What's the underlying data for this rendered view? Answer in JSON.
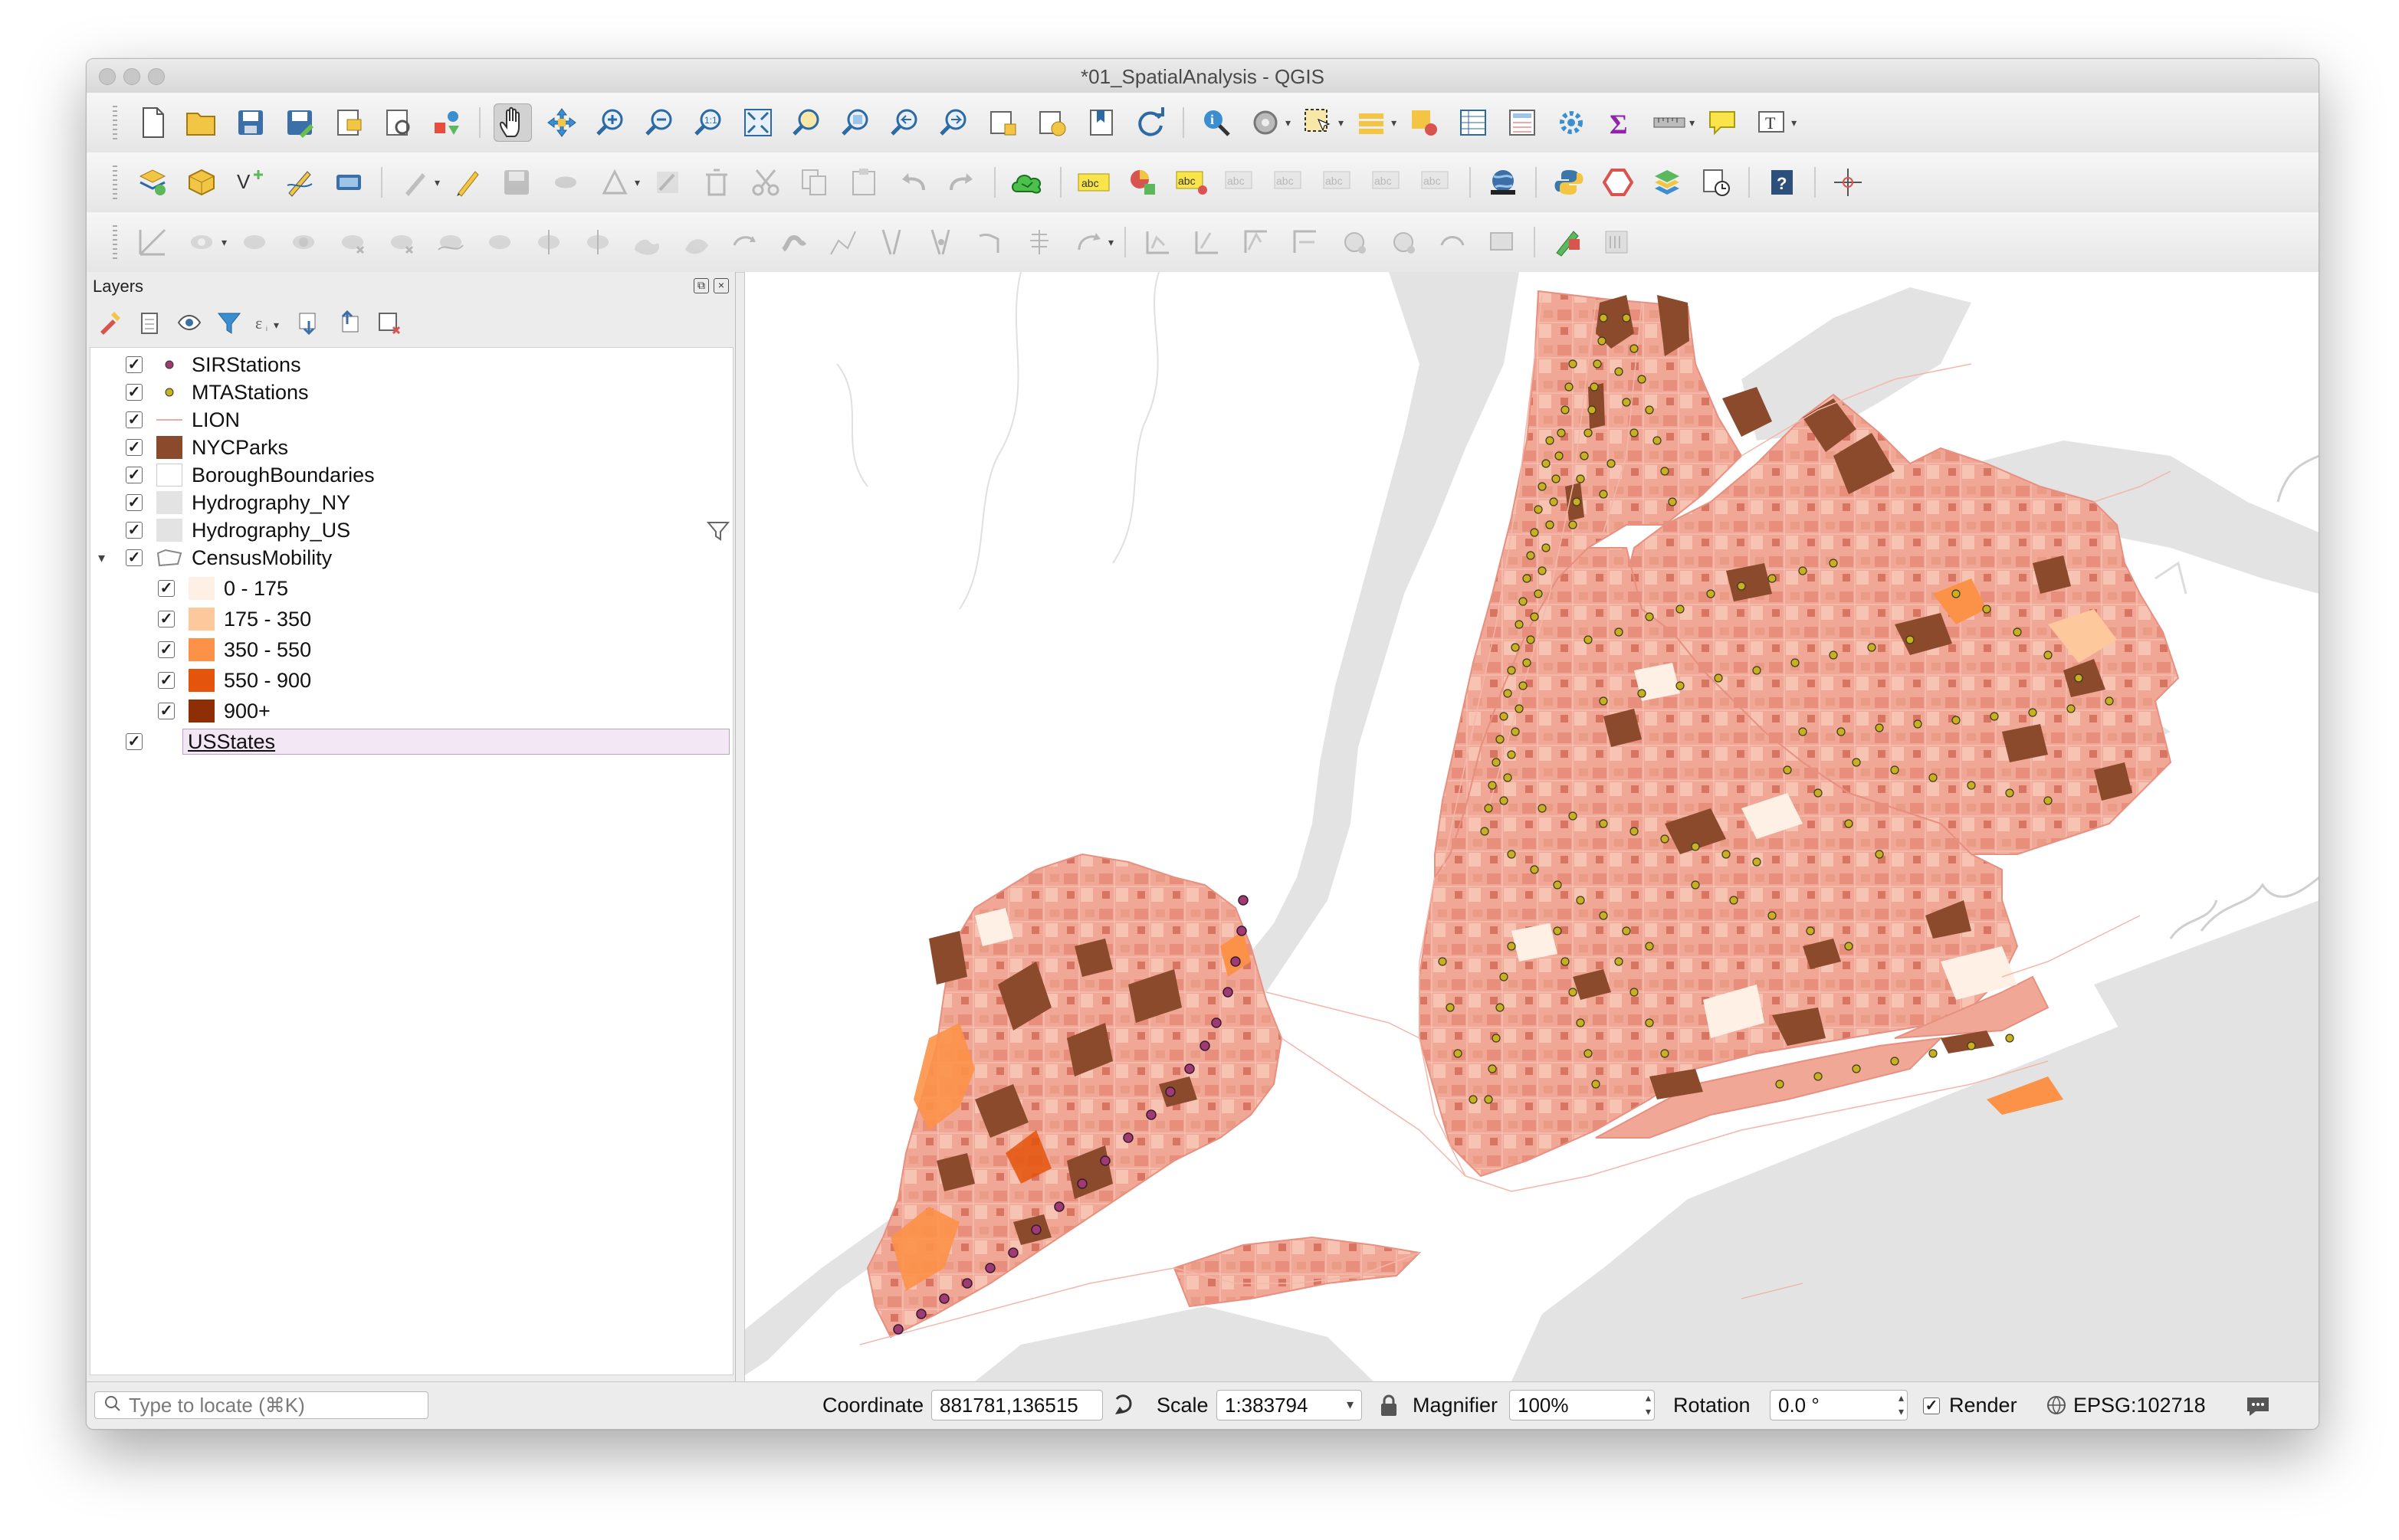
{
  "window": {
    "title": "*01_SpatialAnalysis - QGIS"
  },
  "toolbars": {
    "row1": [
      "new-project-icon",
      "open-project-icon",
      "save-project-icon",
      "save-as-icon",
      "print-layout-icon",
      "layout-manager-icon",
      "style-manager-icon",
      "pan-icon",
      "pan-to-selection-icon",
      "zoom-in-icon",
      "zoom-out-icon",
      "zoom-native-icon",
      "zoom-full-icon",
      "zoom-selection-icon",
      "zoom-layer-icon",
      "zoom-last-icon",
      "zoom-next-icon",
      "new-map-view-icon",
      "temporal-icon",
      "bookmarks-icon",
      "refresh-icon",
      "identify-icon",
      "action-icon",
      "select-icon",
      "select-attribute-icon",
      "deselect-icon",
      "attribute-table-icon",
      "field-calculator-icon",
      "processing-icon",
      "statistics-icon",
      "measure-icon",
      "map-tips-icon",
      "text-annotation-icon"
    ],
    "row2": [
      "data-source-manager-icon",
      "new-geopackage-icon",
      "new-shapefile-icon",
      "digitize-icon",
      "new-virtual-layer-icon",
      "edits-icon",
      "toggle-edit-icon",
      "save-edits-icon",
      "add-feature-icon",
      "vertex-tool-icon",
      "modify-attributes-icon",
      "delete-selected-icon",
      "cut-features-icon",
      "copy-features-icon",
      "paste-features-icon",
      "undo-icon",
      "redo-icon",
      "cloud-icon",
      "label-icon",
      "diagram-icon",
      "label-pin-icon",
      "label-show-hide-icon",
      "label-move-icon",
      "label-rotate-icon",
      "label-change-icon",
      "label-properties-icon",
      "globe-icon",
      "python-icon",
      "plugin-icon",
      "layer-stack-icon",
      "history-icon",
      "help-icon",
      "crosshair-icon"
    ],
    "row3": [
      "advanced-digitize-icon",
      "add-ring-icon",
      "add-part-icon",
      "fill-ring-icon",
      "delete-ring-icon",
      "delete-part-icon",
      "reshape-icon",
      "offset-curve-icon",
      "split-features-icon",
      "split-parts-icon",
      "merge-features-icon",
      "merge-attributes-icon",
      "rotate-symbols-icon",
      "simplify-icon",
      "reverse-line-icon",
      "trim-extend-icon",
      "align-icon",
      "rotate-feature-icon",
      "scale-feature-icon",
      "move-feature-icon",
      "vertex-editor-icon",
      "snapping-icon",
      "tracing-icon",
      "shape-digitize-icon",
      "circle-icon",
      "ellipse-icon",
      "rectangle-icon",
      "regular-polygon-icon",
      "georeferencer-icon",
      "grass-icon"
    ]
  },
  "layers_panel": {
    "title": "Layers",
    "tools": [
      "style-panel-icon",
      "add-group-icon",
      "visibility-icon",
      "filter-legend-icon",
      "expression-filter-icon",
      "expand-all-icon",
      "collapse-all-icon",
      "remove-layer-icon"
    ],
    "items": [
      {
        "name": "SIRStations",
        "checked": "✓",
        "symbol": "point",
        "color": "#9e3b74"
      },
      {
        "name": "MTAStations",
        "checked": "✓",
        "symbol": "point",
        "color": "#b6a020"
      },
      {
        "name": "LION",
        "checked": "✓",
        "symbol": "line",
        "color": "#f0a8a8"
      },
      {
        "name": "NYCParks",
        "checked": "✓",
        "symbol": "fill",
        "color": "#8b4a2b"
      },
      {
        "name": "BoroughBoundaries",
        "checked": "✓",
        "symbol": "fill",
        "color": "#ffffff"
      },
      {
        "name": "Hydrography_NY",
        "checked": "✓",
        "symbol": "fill",
        "color": "#e3e3e3"
      },
      {
        "name": "Hydrography_US",
        "checked": "✓",
        "symbol": "fill",
        "color": "#e3e3e3"
      },
      {
        "name": "CensusMobility",
        "checked": "✓",
        "symbol": "group"
      }
    ],
    "legend": [
      {
        "label": "0 - 175",
        "checked": "✓",
        "color": "#fff0e5"
      },
      {
        "label": "175 - 350",
        "checked": "✓",
        "color": "#fdc89b"
      },
      {
        "label": "350 - 550",
        "checked": "✓",
        "color": "#fc9248"
      },
      {
        "label": "550 - 900",
        "checked": "✓",
        "color": "#e4540c"
      },
      {
        "label": "900+",
        "checked": "✓",
        "color": "#8e2e05"
      }
    ],
    "selected_layer": {
      "name": "USStates",
      "checked": "✓"
    }
  },
  "status": {
    "locate_placeholder": "Type to locate (⌘K)",
    "coordinate_label": "Coordinate",
    "coordinate_value": "881781,136515",
    "scale_label": "Scale",
    "scale_value": "1:383794",
    "magnifier_label": "Magnifier",
    "magnifier_value": "100%",
    "rotation_label": "Rotation",
    "rotation_value": "0.0 °",
    "render_checked": "✓",
    "render_label": "Render",
    "crs": "EPSG:102718"
  },
  "colors": {
    "census_base": "#f0a796",
    "parks": "#8b4a2b",
    "water": "#e3e3e3",
    "mta_station": "#c8b021",
    "sir_station": "#9e3b74"
  }
}
